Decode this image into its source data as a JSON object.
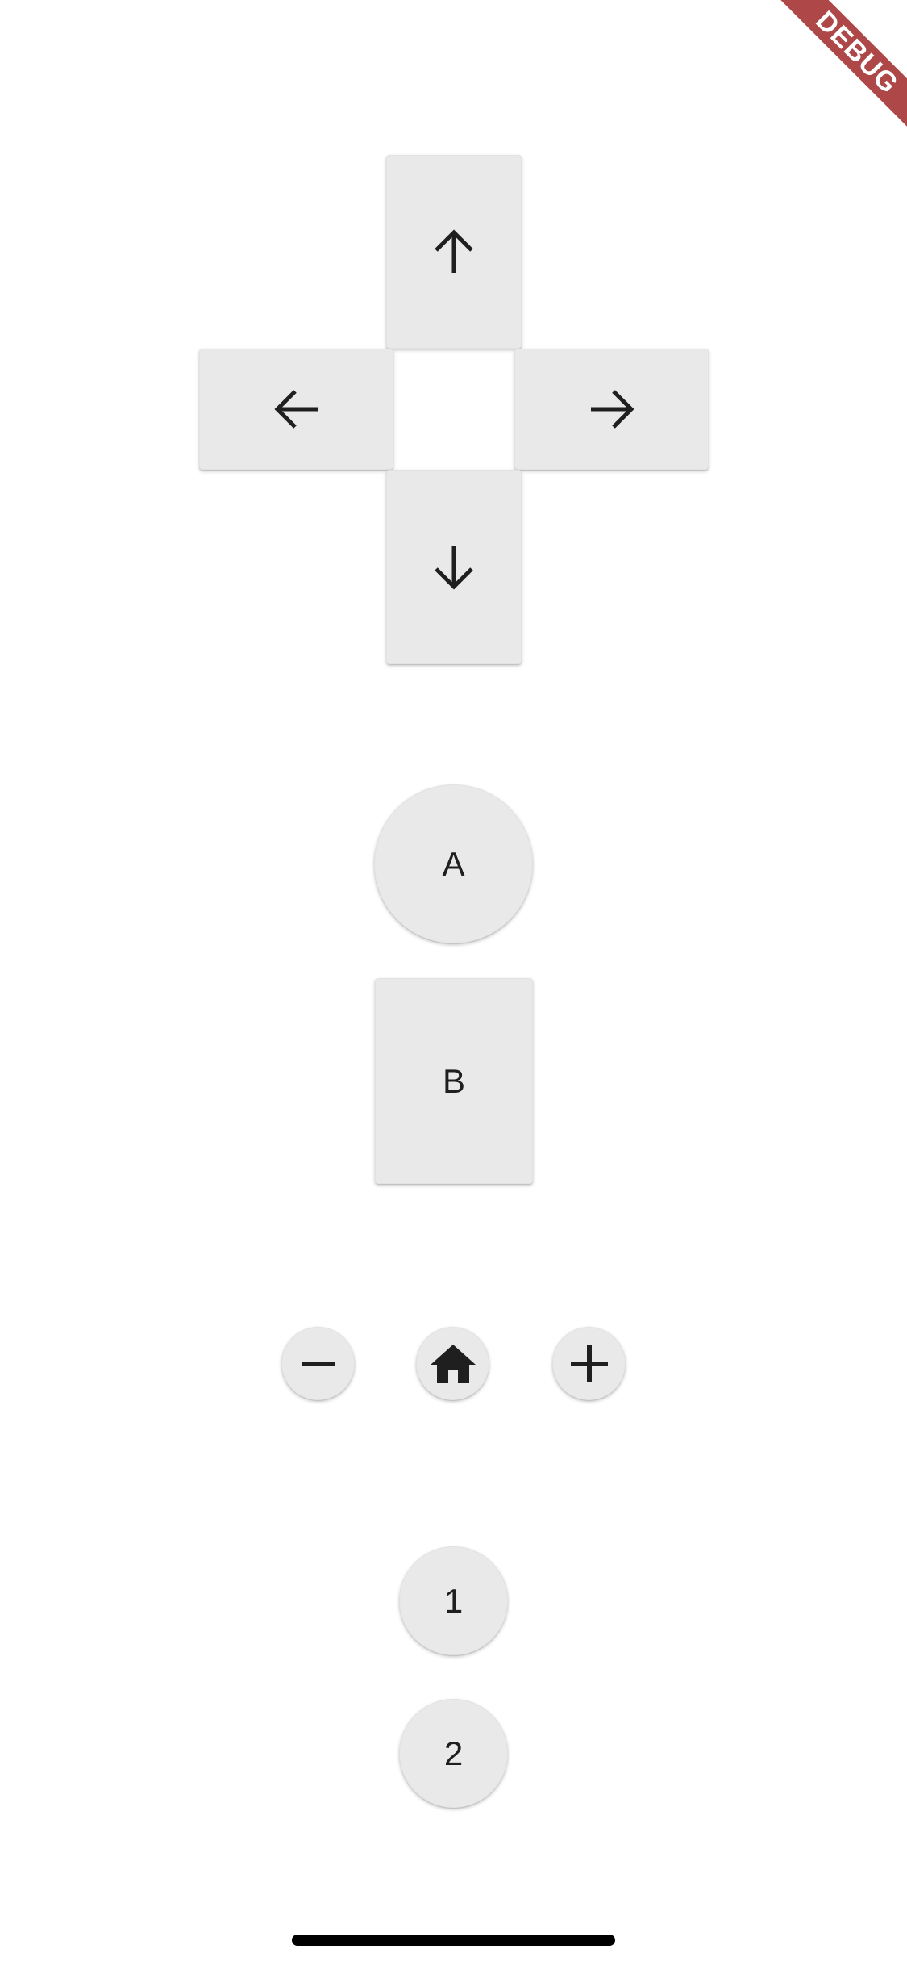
{
  "debug_banner": {
    "text": "DEBUG"
  },
  "dpad": {
    "up": {
      "icon": "arrow-up-icon"
    },
    "left": {
      "icon": "arrow-left-icon"
    },
    "right": {
      "icon": "arrow-right-icon"
    },
    "down": {
      "icon": "arrow-down-icon"
    }
  },
  "buttons": {
    "a_label": "A",
    "b_label": "B",
    "minus_icon": "minus-icon",
    "home_icon": "home-icon",
    "plus_icon": "plus-icon",
    "one_label": "1",
    "two_label": "2"
  },
  "colors": {
    "background": "#ffffff",
    "button_fill": "#e9e9e9",
    "icon": "#1f1f1f",
    "debug_banner": "#a02828"
  }
}
